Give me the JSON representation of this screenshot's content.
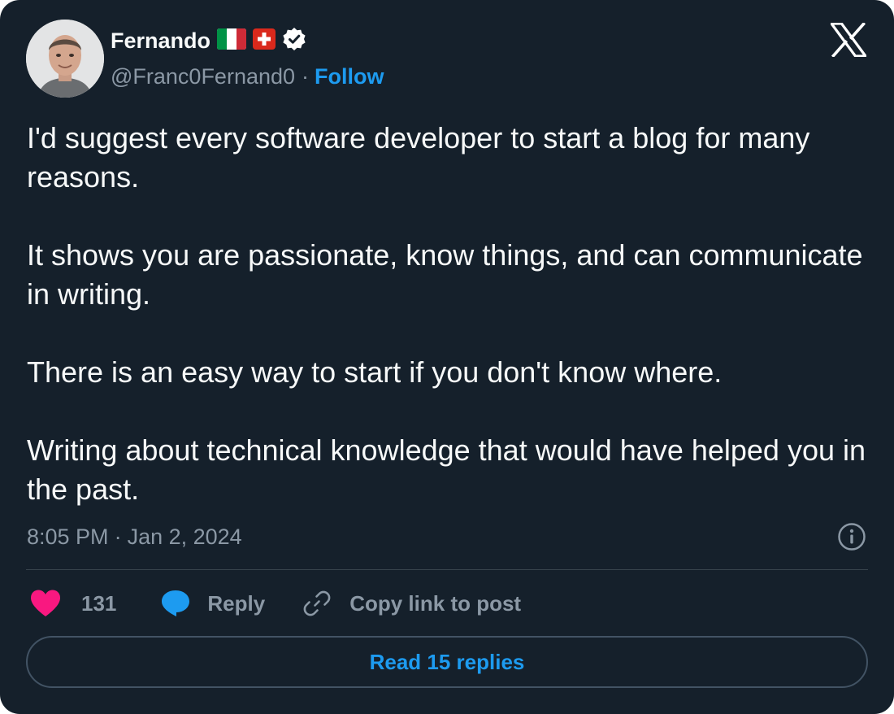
{
  "author": {
    "name": "Fernando",
    "handle": "@Franc0Fernand0",
    "follow_label": "Follow",
    "flags": [
      "italy-flag",
      "switzerland-flag"
    ],
    "verified_badge": "verified-badge-icon"
  },
  "post": {
    "paragraphs": [
      "I'd suggest every software developer to start a blog for many reasons.",
      "It shows you are passionate, know things, and can communicate in writing.",
      "There is an easy way to start if you don't know where.",
      "Writing about technical knowledge that would have helped you in the past."
    ],
    "time": "8:05 PM",
    "date": "Jan 2, 2024"
  },
  "actions": {
    "like_count": "131",
    "reply_label": "Reply",
    "copy_label": "Copy link to post"
  },
  "footer": {
    "read_replies_label": "Read 15 replies"
  },
  "colors": {
    "background": "#15202b",
    "text": "#f7f9f9",
    "muted": "#8b98a5",
    "accent": "#1d9bf0",
    "like": "#f91880",
    "border": "#425364"
  },
  "icons": {
    "platform": "x-logo-icon",
    "info": "info-icon",
    "like": "heart-icon",
    "reply": "speech-bubble-icon",
    "copy": "link-icon"
  }
}
